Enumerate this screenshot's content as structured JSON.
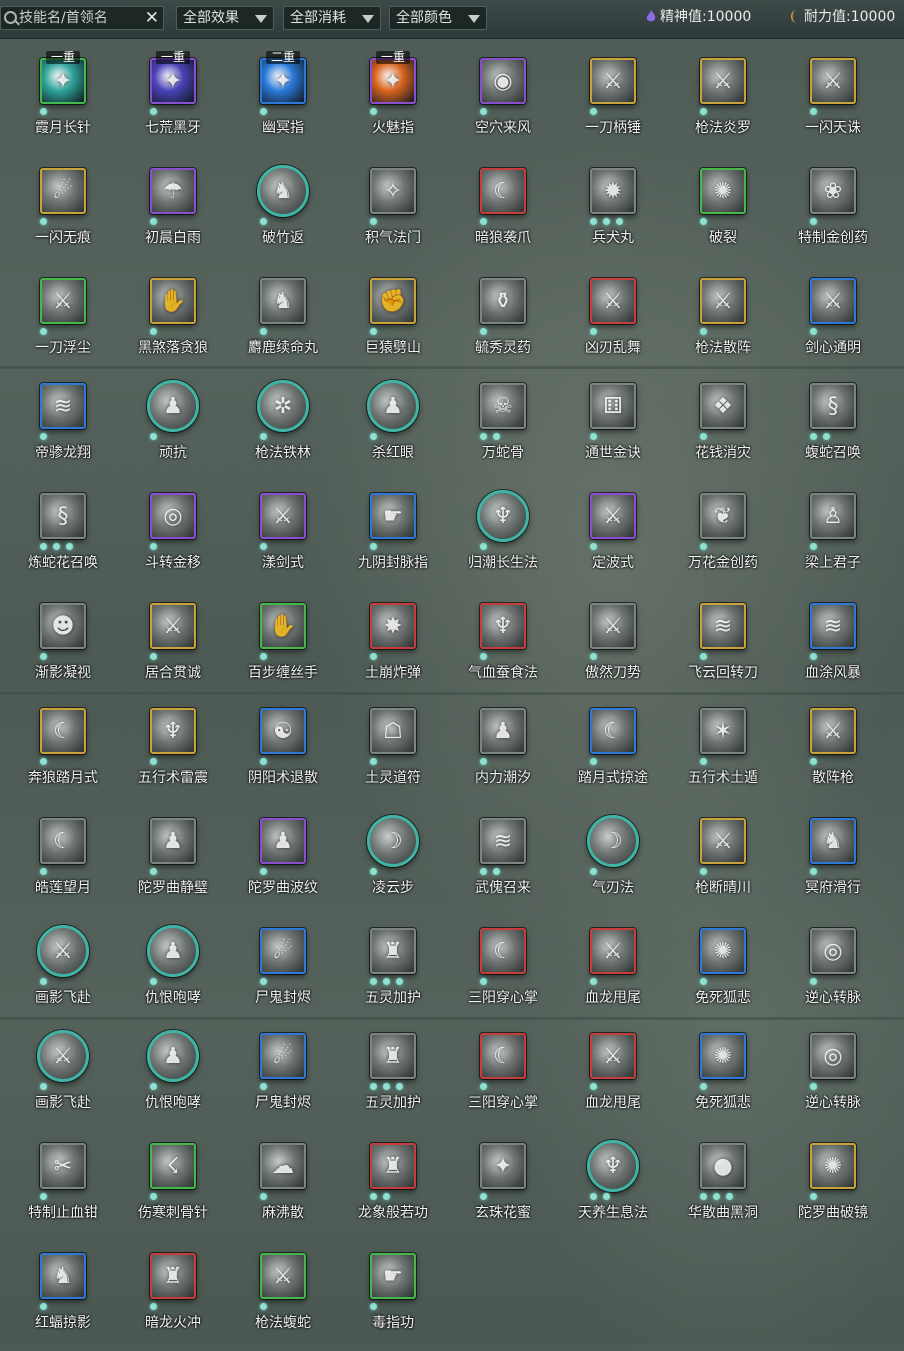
{
  "toolbar": {
    "search_placeholder": "技能名/首领名",
    "clear_glyph": "✕",
    "filters": [
      {
        "label": "全部效果"
      },
      {
        "label": "全部消耗"
      },
      {
        "label": "全部颜色"
      }
    ],
    "spirit_label": "精神值:10000",
    "stamina_label": "耐力值:10000",
    "spirit_icon": "purple-flame-icon",
    "stamina_icon": "orange-moon-icon"
  },
  "border_colors": {
    "green": "#44b84a",
    "purple": "#8a4fd0",
    "blue": "#2f78d8",
    "gold": "#c9a23a",
    "red": "#c63d3d",
    "teal": "#3fb3a4",
    "grey": "#7d8584"
  },
  "skills": [
    {
      "name": "霞月长针",
      "border": "green",
      "tier": "一重",
      "dots": 1,
      "fill": "#2fa39a",
      "glyph": "✦"
    },
    {
      "name": "七荒黑牙",
      "border": "purple",
      "tier": "一重",
      "dots": 1,
      "fill": "#4a43b8",
      "glyph": "✦"
    },
    {
      "name": "幽冥指",
      "border": "blue",
      "tier": "二重",
      "dots": 1,
      "fill": "#2a7ad8",
      "glyph": "✦"
    },
    {
      "name": "火魅指",
      "border": "purple",
      "tier": "一重",
      "dots": 1,
      "fill": "#d8641e",
      "glyph": "✦"
    },
    {
      "name": "空穴来风",
      "border": "purple",
      "dots": 1,
      "glyph": "◉"
    },
    {
      "name": "一刀柄锤",
      "border": "gold",
      "dots": 1,
      "glyph": "⚔"
    },
    {
      "name": "枪法炎罗",
      "border": "gold",
      "dots": 1,
      "glyph": "⚔"
    },
    {
      "name": "一闪天诛",
      "border": "gold",
      "dots": 1,
      "glyph": "⚔"
    },
    {
      "name": "一闪无痕",
      "border": "gold",
      "dots": 1,
      "glyph": "☄"
    },
    {
      "name": "初晨白雨",
      "border": "purple",
      "dots": 1,
      "glyph": "☂"
    },
    {
      "name": "破竹返",
      "border": "teal",
      "circle": true,
      "dots": 1,
      "glyph": "♞"
    },
    {
      "name": "积气法门",
      "border": "grey",
      "dots": 1,
      "glyph": "✧"
    },
    {
      "name": "暗狼袭爪",
      "border": "red",
      "dots": 1,
      "glyph": "☾"
    },
    {
      "name": "兵犬丸",
      "border": "grey",
      "dots": 3,
      "glyph": "✹"
    },
    {
      "name": "破裂",
      "border": "green",
      "dots": 1,
      "glyph": "✺"
    },
    {
      "name": "特制金创药",
      "border": "grey",
      "dots": 1,
      "glyph": "❀"
    },
    {
      "name": "一刀浮尘",
      "border": "green",
      "dots": 1,
      "glyph": "⚔"
    },
    {
      "name": "黑煞落贪狼",
      "border": "gold",
      "dots": 1,
      "glyph": "✋"
    },
    {
      "name": "麝鹿续命丸",
      "border": "grey",
      "dots": 1,
      "glyph": "♞"
    },
    {
      "name": "巨猿劈山",
      "border": "gold",
      "dots": 1,
      "glyph": "✊"
    },
    {
      "name": "毓秀灵药",
      "border": "grey",
      "dots": 1,
      "glyph": "⚱"
    },
    {
      "name": "凶刃乱舞",
      "border": "red",
      "dots": 1,
      "glyph": "⚔"
    },
    {
      "name": "枪法散阵",
      "border": "gold",
      "dots": 1,
      "glyph": "⚔"
    },
    {
      "name": "剑心通明",
      "border": "blue",
      "dots": 1,
      "glyph": "⚔"
    },
    {
      "name": "帝骖龙翔",
      "border": "blue",
      "dots": 1,
      "glyph": "≋"
    },
    {
      "name": "顽抗",
      "border": "teal",
      "circle": true,
      "dots": 1,
      "glyph": "♟"
    },
    {
      "name": "枪法铁林",
      "border": "teal",
      "circle": true,
      "dots": 1,
      "glyph": "✲"
    },
    {
      "name": "杀红眼",
      "border": "teal",
      "circle": true,
      "dots": 1,
      "glyph": "♟"
    },
    {
      "name": "万蛇骨",
      "border": "grey",
      "dots": 2,
      "glyph": "☠"
    },
    {
      "name": "通世金诀",
      "border": "grey",
      "dots": 1,
      "glyph": "⚅"
    },
    {
      "name": "花钱消灾",
      "border": "grey",
      "dots": 1,
      "glyph": "❖"
    },
    {
      "name": "蝮蛇召唤",
      "border": "grey",
      "dots": 2,
      "glyph": "§"
    },
    {
      "name": "炼蛇花召唤",
      "border": "grey",
      "dots": 3,
      "glyph": "§"
    },
    {
      "name": "斗转金移",
      "border": "purple",
      "dots": 1,
      "glyph": "◎"
    },
    {
      "name": "漾剑式",
      "border": "purple",
      "dots": 1,
      "glyph": "⚔"
    },
    {
      "name": "九阴封脉指",
      "border": "blue",
      "dots": 1,
      "glyph": "☛"
    },
    {
      "name": "归潮长生法",
      "border": "teal",
      "circle": true,
      "dots": 1,
      "glyph": "♆"
    },
    {
      "name": "定波式",
      "border": "purple",
      "dots": 1,
      "glyph": "⚔"
    },
    {
      "name": "万花金创药",
      "border": "grey",
      "dots": 1,
      "glyph": "❦"
    },
    {
      "name": "梁上君子",
      "border": "grey",
      "dots": 1,
      "glyph": "♙"
    },
    {
      "name": "渐影凝视",
      "border": "grey",
      "dots": 1,
      "glyph": "☻"
    },
    {
      "name": "居合贯诚",
      "border": "gold",
      "dots": 1,
      "glyph": "⚔"
    },
    {
      "name": "百步缠丝手",
      "border": "green",
      "dots": 1,
      "glyph": "✋"
    },
    {
      "name": "土崩炸弹",
      "border": "red",
      "dots": 1,
      "glyph": "✸"
    },
    {
      "name": "气血蚕食法",
      "border": "red",
      "dots": 1,
      "glyph": "♆"
    },
    {
      "name": "傲然刀势",
      "border": "grey",
      "dots": 1,
      "glyph": "⚔"
    },
    {
      "name": "飞云回转刀",
      "border": "gold",
      "dots": 1,
      "glyph": "≋"
    },
    {
      "name": "血涂风暴",
      "border": "blue",
      "dots": 1,
      "glyph": "≋"
    },
    {
      "name": "奔狼踏月式",
      "border": "gold",
      "dots": 1,
      "glyph": "☾"
    },
    {
      "name": "五行术雷震",
      "border": "gold",
      "dots": 1,
      "glyph": "♆"
    },
    {
      "name": "阴阳术退散",
      "border": "blue",
      "dots": 1,
      "glyph": "☯"
    },
    {
      "name": "土灵道符",
      "border": "grey",
      "dots": 1,
      "glyph": "☖"
    },
    {
      "name": "内力潮汐",
      "border": "grey",
      "dots": 1,
      "glyph": "♟"
    },
    {
      "name": "踏月式掠途",
      "border": "blue",
      "dots": 1,
      "glyph": "☾"
    },
    {
      "name": "五行术土遁",
      "border": "grey",
      "dots": 1,
      "glyph": "✶"
    },
    {
      "name": "散阵枪",
      "border": "gold",
      "dots": 1,
      "glyph": "⚔"
    },
    {
      "name": "皓莲望月",
      "border": "grey",
      "dots": 1,
      "glyph": "☾"
    },
    {
      "name": "陀罗曲静璧",
      "border": "grey",
      "dots": 1,
      "glyph": "♟"
    },
    {
      "name": "陀罗曲波纹",
      "border": "purple",
      "dots": 1,
      "glyph": "♟"
    },
    {
      "name": "凌云步",
      "border": "teal",
      "circle": true,
      "dots": 1,
      "glyph": "☽"
    },
    {
      "name": "武傀召来",
      "border": "grey",
      "dots": 2,
      "glyph": "≋"
    },
    {
      "name": "气刃法",
      "border": "teal",
      "circle": true,
      "dots": 1,
      "glyph": "☽"
    },
    {
      "name": "枪断晴川",
      "border": "gold",
      "dots": 1,
      "glyph": "⚔"
    },
    {
      "name": "冥府滑行",
      "border": "blue",
      "dots": 1,
      "glyph": "♞"
    },
    {
      "name": "画影飞赴",
      "border": "teal",
      "circle": true,
      "dots": 1,
      "glyph": "⚔"
    },
    {
      "name": "仇恨咆哮",
      "border": "teal",
      "circle": true,
      "dots": 1,
      "glyph": "♟"
    },
    {
      "name": "尸鬼封烬",
      "border": "blue",
      "dots": 1,
      "glyph": "☄"
    },
    {
      "name": "五灵加护",
      "border": "grey",
      "dots": 3,
      "glyph": "♜"
    },
    {
      "name": "三阳穿心掌",
      "border": "red",
      "dots": 1,
      "glyph": "☾"
    },
    {
      "name": "血龙甩尾",
      "border": "red",
      "dots": 1,
      "glyph": "⚔"
    },
    {
      "name": "免死狐悲",
      "border": "blue",
      "dots": 1,
      "glyph": "✺"
    },
    {
      "name": "逆心转脉",
      "border": "grey",
      "dots": 1,
      "glyph": "◎"
    },
    {
      "name": "画影飞赴",
      "border": "teal",
      "circle": true,
      "dots": 1,
      "glyph": "⚔"
    },
    {
      "name": "仇恨咆哮",
      "border": "teal",
      "circle": true,
      "dots": 1,
      "glyph": "♟"
    },
    {
      "name": "尸鬼封烬",
      "border": "blue",
      "dots": 1,
      "glyph": "☄"
    },
    {
      "name": "五灵加护",
      "border": "grey",
      "dots": 3,
      "glyph": "♜"
    },
    {
      "name": "三阳穿心掌",
      "border": "red",
      "dots": 1,
      "glyph": "☾"
    },
    {
      "name": "血龙甩尾",
      "border": "red",
      "dots": 1,
      "glyph": "⚔"
    },
    {
      "name": "免死狐悲",
      "border": "blue",
      "dots": 1,
      "glyph": "✺"
    },
    {
      "name": "逆心转脉",
      "border": "grey",
      "dots": 1,
      "glyph": "◎"
    },
    {
      "name": "特制止血钳",
      "border": "grey",
      "dots": 1,
      "glyph": "✂"
    },
    {
      "name": "伤寒刺骨针",
      "border": "green",
      "dots": 1,
      "glyph": "☇"
    },
    {
      "name": "麻沸散",
      "border": "grey",
      "dots": 1,
      "glyph": "☁"
    },
    {
      "name": "龙象般若功",
      "border": "red",
      "dots": 2,
      "glyph": "♜"
    },
    {
      "name": "玄珠花蜜",
      "border": "grey",
      "dots": 1,
      "glyph": "✦"
    },
    {
      "name": "天养生息法",
      "border": "teal",
      "circle": true,
      "dots": 2,
      "glyph": "♆"
    },
    {
      "name": "华散曲黑洞",
      "border": "grey",
      "dots": 3,
      "glyph": "●"
    },
    {
      "name": "陀罗曲破镜",
      "border": "gold",
      "dots": 1,
      "glyph": "✺"
    },
    {
      "name": "红蝠掠影",
      "border": "blue",
      "dots": 1,
      "glyph": "♞"
    },
    {
      "name": "暗龙火冲",
      "border": "red",
      "dots": 1,
      "glyph": "♜"
    },
    {
      "name": "枪法蝮蛇",
      "border": "green",
      "dots": 1,
      "glyph": "⚔"
    },
    {
      "name": "毒指功",
      "border": "green",
      "dots": 1,
      "glyph": "☛"
    }
  ]
}
